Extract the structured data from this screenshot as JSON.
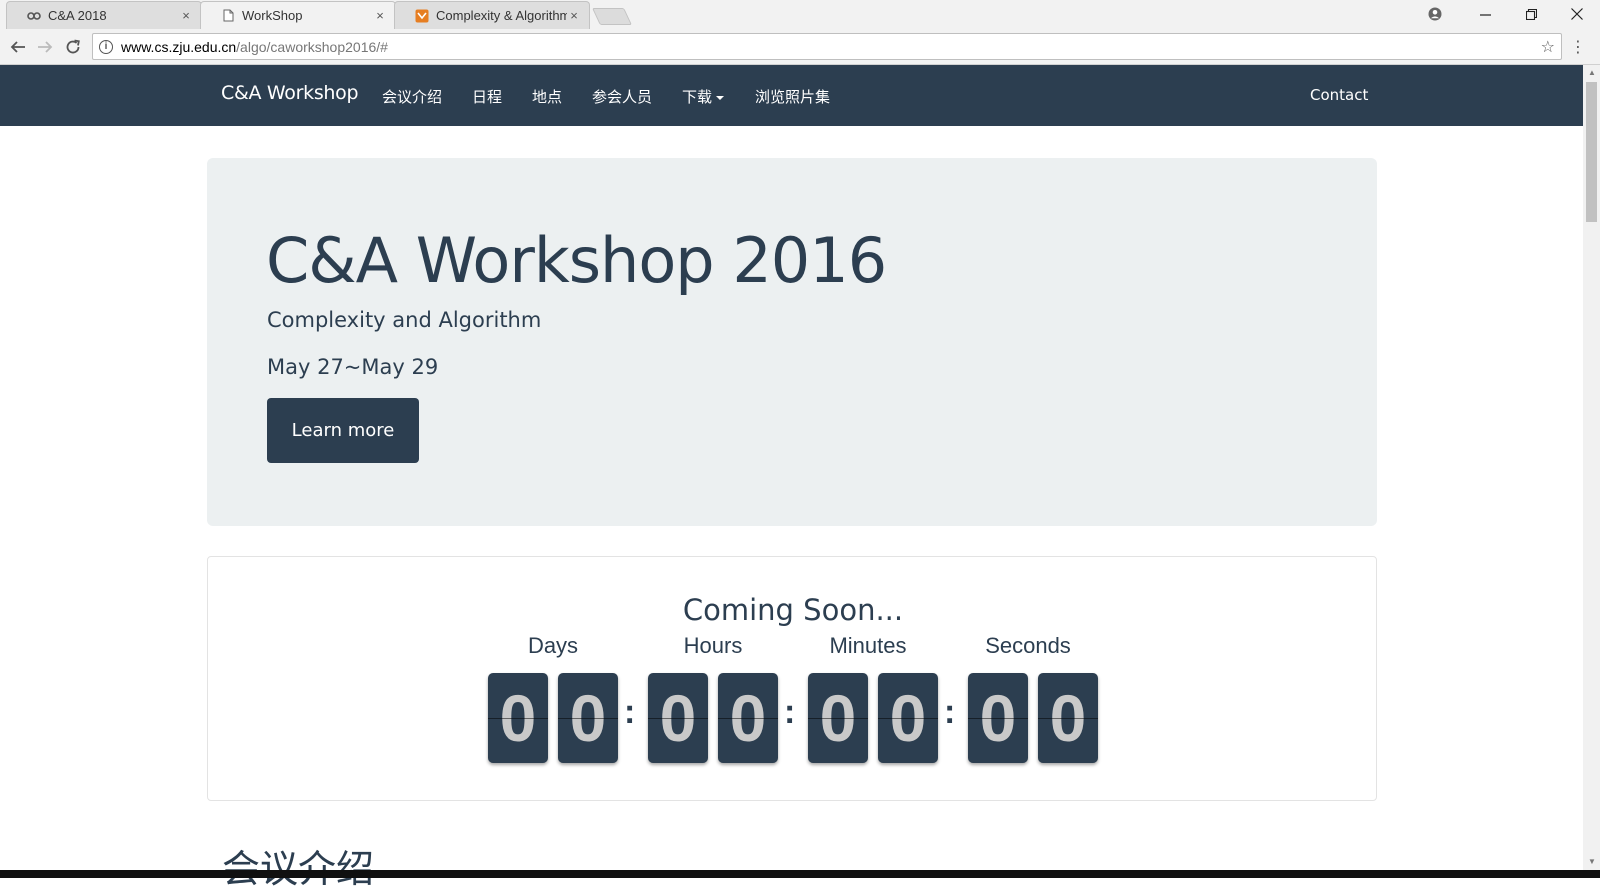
{
  "browser": {
    "tabs": [
      {
        "title": "C&A 2018",
        "icon": "link-icon",
        "close": "×"
      },
      {
        "title": "WorkShop",
        "icon": "page-icon",
        "close": "×"
      },
      {
        "title": "Complexity & Algorithm",
        "icon": "site-favicon",
        "close": "×"
      }
    ],
    "url_host": "www.cs.zju.edu.cn",
    "url_path": "/algo/caworkshop2016/#"
  },
  "navbar": {
    "brand": "C&A Workshop",
    "links": [
      "会议介绍",
      "日程",
      "地点",
      "参会人员",
      "下载",
      "浏览照片集"
    ],
    "contact": "Contact"
  },
  "jumbotron": {
    "title": "C&A Workshop 2016",
    "subtitle": "Complexity and Algorithm",
    "dates": "May 27~May 29",
    "button": "Learn more"
  },
  "countdown": {
    "heading": "Coming Soon...",
    "labels": [
      "Days",
      "Hours",
      "Minutes",
      "Seconds"
    ],
    "digits": [
      "0",
      "0",
      "0",
      "0",
      "0",
      "0",
      "0",
      "0"
    ],
    "separator": ":"
  },
  "section": {
    "title": "会议介绍"
  },
  "colors": {
    "navbar_bg": "#2c3e50",
    "jumbotron_bg": "#ecf0f1",
    "digit_bg": "#2c3e50"
  }
}
